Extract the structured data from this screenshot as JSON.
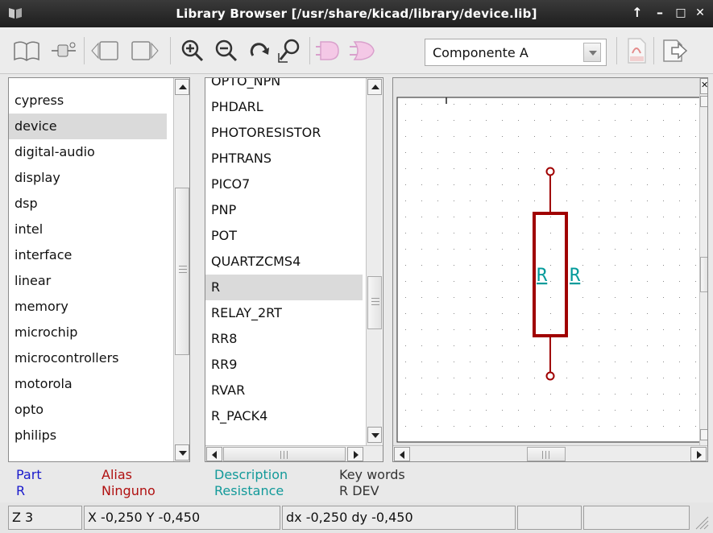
{
  "window": {
    "title": "Library Browser [/usr/share/kicad/library/device.lib]",
    "controls": [
      "↑",
      "–",
      "□",
      "✕"
    ]
  },
  "toolbar": {
    "unit_select": {
      "value": "Componente A"
    }
  },
  "libraries": {
    "items": [
      "cypress",
      "device",
      "digital-audio",
      "display",
      "dsp",
      "intel",
      "interface",
      "linear",
      "memory",
      "microchip",
      "microcontrollers",
      "motorola",
      "opto",
      "philips"
    ],
    "selected": "device"
  },
  "components": {
    "clipped_top": "OPTO_NPN",
    "items": [
      "PHDARL",
      "PHOTORESISTOR",
      "PHTRANS",
      "PICO7",
      "PNP",
      "POT",
      "QUARTZCMS4",
      "R",
      "RELAY_2RT",
      "RR8",
      "RR9",
      "RVAR",
      "R_PACK4"
    ],
    "selected": "R"
  },
  "preview": {
    "labels": [
      "R",
      "R"
    ],
    "colors": {
      "body": "#a00000",
      "pin": "#a00000",
      "label": "#009a9a",
      "grid": "#8a8a8a"
    }
  },
  "info": {
    "headers": {
      "part": "Part",
      "alias": "Alias",
      "description": "Description",
      "keywords": "Key words"
    },
    "values": {
      "part": "R",
      "alias": "Ninguno",
      "description": "Resistance",
      "keywords": "R DEV"
    },
    "colors": {
      "part": "#1a1acc",
      "alias": "#b01010",
      "description": "#139a9a",
      "keywords": "#333333"
    }
  },
  "status": {
    "zoom": "Z 3",
    "coords": "X -0,250  Y -0,450",
    "delta": "dx -0,250  dy -0,450"
  }
}
